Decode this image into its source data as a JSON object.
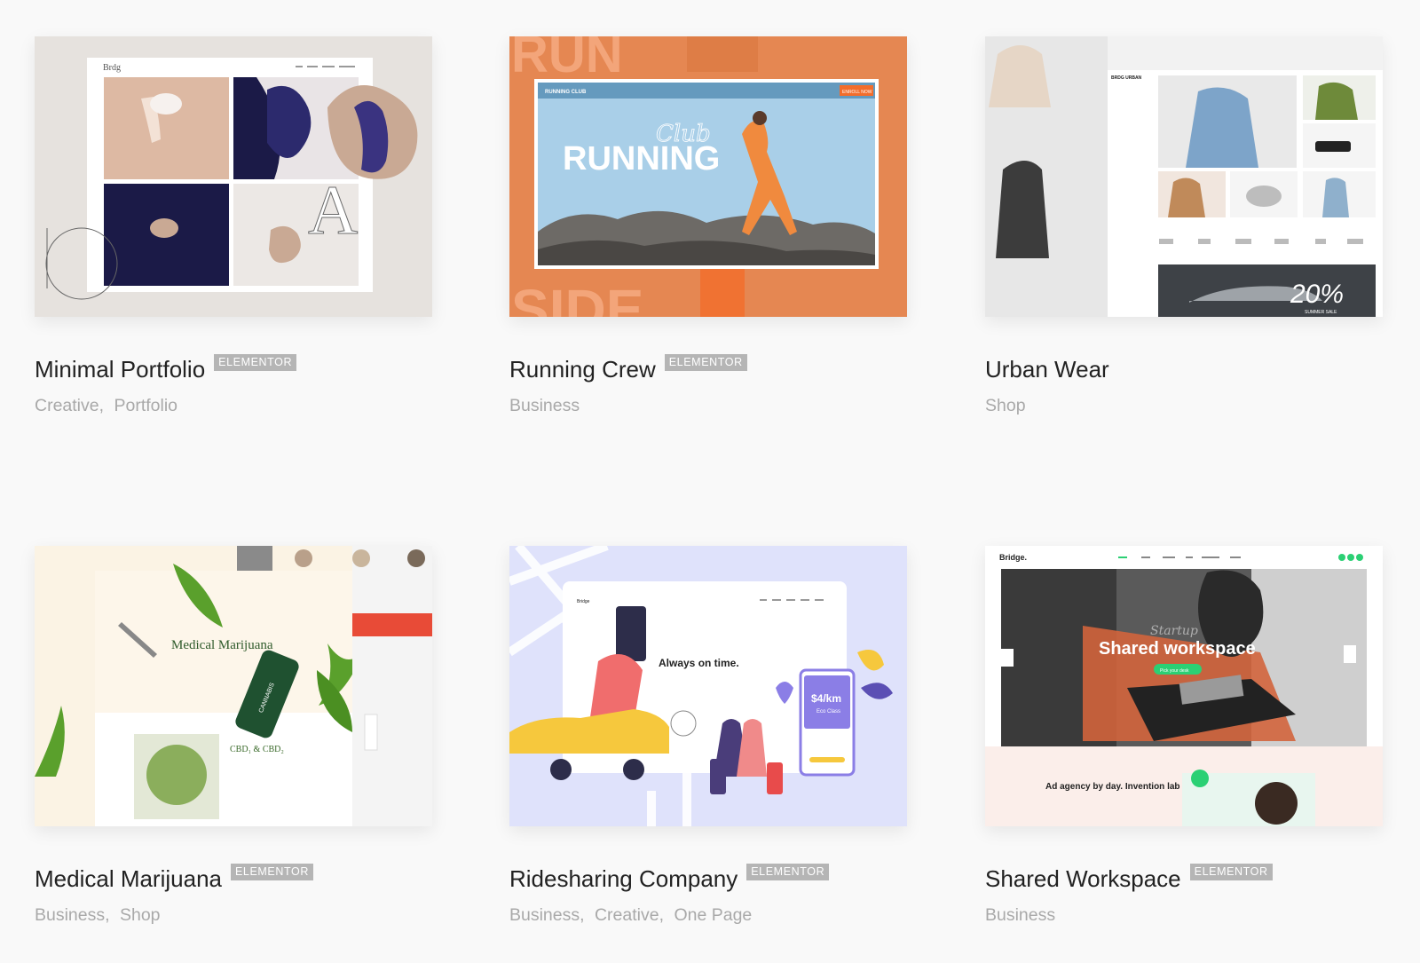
{
  "badge_label": "ELEMENTOR",
  "cards": [
    {
      "title": "Minimal Portfolio",
      "has_badge": true,
      "categories": [
        "Creative",
        "Portfolio"
      ],
      "thumb": {
        "brand": "Brdg",
        "letter": "A",
        "colors": {
          "bg": "#e6e2de",
          "navy": "#1b1a47",
          "tan": "#c9a994",
          "accent": "#3a3380"
        }
      }
    },
    {
      "title": "Running Crew",
      "has_badge": true,
      "categories": [
        "Business"
      ],
      "thumb": {
        "brand": "RUNNING CLUB",
        "hero": "RUNNING",
        "script": "Club",
        "big_left_top": "RUN",
        "big_left_bottom": "SIDE",
        "cta": "ENROLL NOW",
        "colors": {
          "bg": "#e58752",
          "sky": "#a9cfe8",
          "runner": "#f08a3e"
        }
      }
    },
    {
      "title": "Urban Wear",
      "has_badge": false,
      "categories": [
        "Shop"
      ],
      "thumb": {
        "brand": "BRDG URBAN",
        "sale": "20%",
        "sale_sub": "SUMMER SALE",
        "colors": {
          "bg": "#f2f2f2",
          "denim": "#7da4c9",
          "olive": "#6e8a3a"
        }
      }
    },
    {
      "title": "Medical Marijuana",
      "has_badge": true,
      "categories": [
        "Business",
        "Shop"
      ],
      "thumb": {
        "hero": "Medical Marijuana",
        "label": "CANNABIS",
        "cbd": "CBD₁ & CBD₂",
        "colors": {
          "bg": "#fbf3e4",
          "leaf": "#5aa02c",
          "bottle": "#1f5130",
          "red": "#e84b37"
        }
      }
    },
    {
      "title": "Ridesharing Company",
      "has_badge": true,
      "categories": [
        "Business",
        "Creative",
        "One Page"
      ],
      "thumb": {
        "brand": "Bridge",
        "hero": "Always on time.",
        "price": "$4/km",
        "price_sub": "Eco Class",
        "colors": {
          "bg": "#dfe2fb",
          "purple": "#8b7ee6",
          "car": "#f6c83d"
        }
      }
    },
    {
      "title": "Shared Workspace",
      "has_badge": true,
      "categories": [
        "Business"
      ],
      "thumb": {
        "brand": "Bridge.",
        "script": "Startup",
        "hero": "Shared workspace",
        "cta": "Pick your desk",
        "headline": "Ad agency by day. Invention lab by night.",
        "colors": {
          "bg": "#fbeeea",
          "green": "#2bd074",
          "chair": "#d2643c"
        }
      }
    }
  ]
}
